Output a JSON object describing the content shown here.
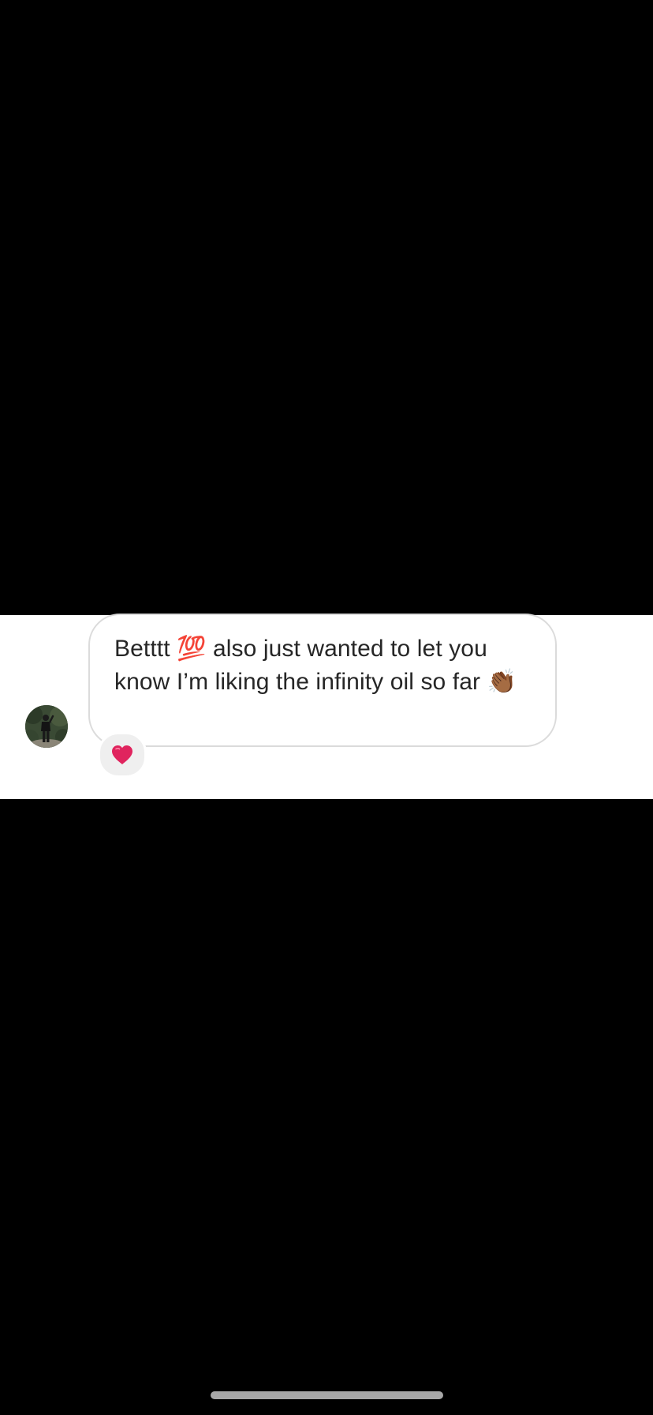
{
  "thread": {
    "message": {
      "text": "Betttt 💯  also just wanted to let you know I’m liking the infinity oil so far 👏🏾"
    },
    "reaction": {
      "emoji": "❤️",
      "icon": "heart-icon"
    },
    "sender": {
      "avatar_icon": "avatar-photo"
    }
  },
  "system": {
    "home_indicator_icon": "home-indicator"
  },
  "colors": {
    "background": "#000000",
    "panel": "#ffffff",
    "bubble_border": "#dbdbdb",
    "text": "#262626",
    "reaction_bg": "#efefef",
    "heart": "#e0245e"
  }
}
